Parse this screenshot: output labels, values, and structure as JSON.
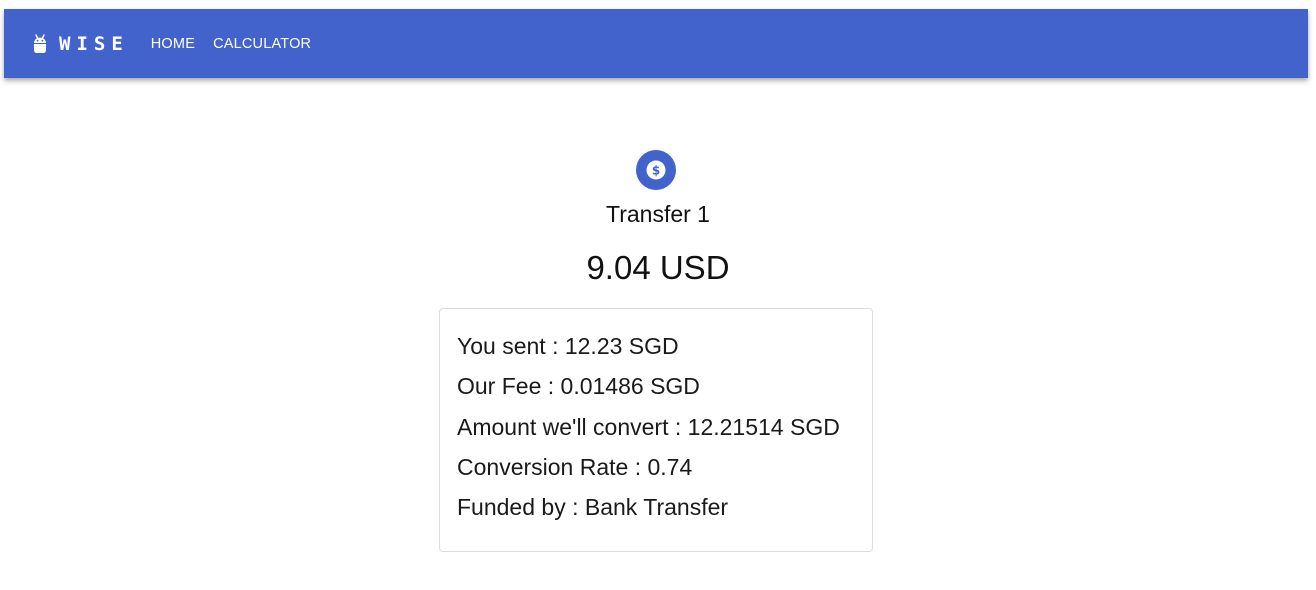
{
  "app": {
    "brand": "WISE",
    "brand_icon": "android-icon",
    "accent_color": "#4263cc"
  },
  "nav": {
    "items": [
      {
        "label": "HOME"
      },
      {
        "label": "CALCULATOR"
      }
    ]
  },
  "transfer": {
    "icon": "dollar-coin-icon",
    "title": "Transfer 1",
    "amount": "9.04 USD",
    "details": [
      {
        "text": "You sent : 12.23 SGD"
      },
      {
        "text": "Our Fee : 0.01486 SGD"
      },
      {
        "text": "Amount we'll convert : 12.21514 SGD"
      },
      {
        "text": "Conversion Rate : 0.74"
      },
      {
        "text": "Funded by : Bank Transfer"
      }
    ]
  }
}
